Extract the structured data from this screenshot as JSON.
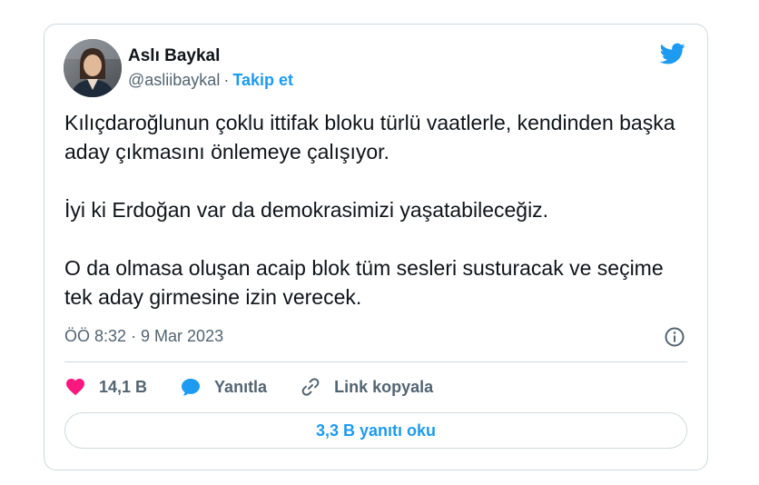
{
  "author": {
    "name": "Aslı Baykal",
    "handle": "@asliibaykal",
    "separator": "·",
    "follow_label": "Takip et"
  },
  "tweet": {
    "paragraphs": [
      "Kılıçdaroğlunun çoklu ittifak bloku türlü vaatlerle, kendinden başka aday çıkmasını önlemeye çalışıyor.",
      "İyi ki Erdoğan var da demokrasimizi yaşatabileceğiz.",
      "O da olmasa oluşan acaip blok tüm sesleri susturacak ve seçime tek aday girmesine izin verecek."
    ],
    "timestamp": "ÖÖ 8:32 · 9 Mar 2023"
  },
  "actions": {
    "likes": "14,1 B",
    "reply_label": "Yanıtla",
    "copy_link_label": "Link kopyala"
  },
  "read_replies_label": "3,3 B yanıtı oku",
  "icons": {
    "brand": "twitter-bird-icon",
    "info": "info-icon",
    "like": "heart-icon",
    "reply": "speech-bubble-icon",
    "link": "link-icon"
  },
  "colors": {
    "accent": "#1d9bf0",
    "like": "#f91880",
    "text": "#0f1419",
    "muted": "#536471",
    "border": "#cfd9de"
  }
}
